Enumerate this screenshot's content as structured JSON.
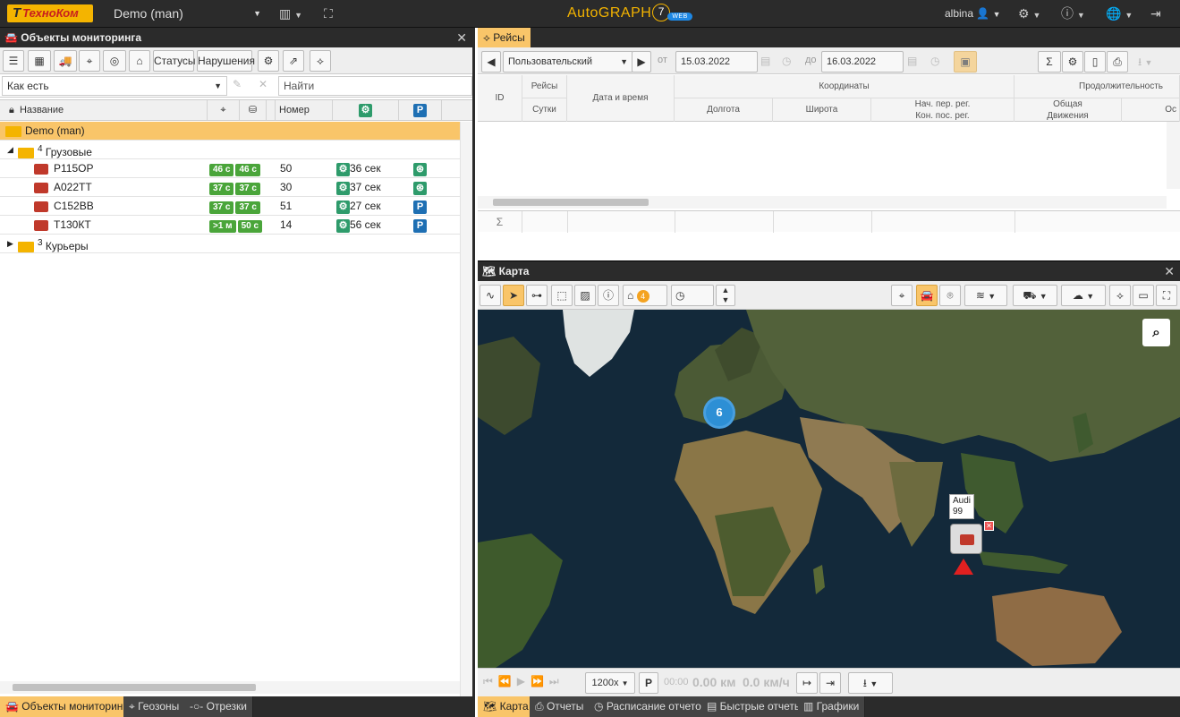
{
  "topbar": {
    "logo_text": "ТехноКом",
    "workspace": "Demo (man)",
    "brand": "AutoGRAPH",
    "brand_version": "7",
    "brand_badge": "WEB",
    "user": "albina",
    "icons": [
      "layout-icon",
      "fullscreen-icon",
      "user-icon",
      "settings-icon",
      "info-icon",
      "globe-icon",
      "logout-icon"
    ]
  },
  "objects_panel": {
    "title": "Объекты мониторинга",
    "toolbar": {
      "statuses": "Статусы",
      "violations": "Нарушения"
    },
    "filter": {
      "value": "Как есть",
      "search_placeholder": "Найти"
    },
    "columns": {
      "name": "Название",
      "number": "Номер"
    },
    "root": "Demo (man)",
    "groups": [
      {
        "count": "4",
        "label": "Грузовые"
      },
      {
        "count": "3",
        "label": "Курьеры"
      }
    ],
    "vehicles": [
      {
        "name": "Р115ОР",
        "b1": "46 с",
        "b2": "46 с",
        "number": "50",
        "status": "36 сек",
        "state": "drive"
      },
      {
        "name": "А022ТТ",
        "b1": "37 с",
        "b2": "37 с",
        "number": "30",
        "status": "37 сек",
        "state": "drive"
      },
      {
        "name": "С152ВВ",
        "b1": "37 с",
        "b2": "37 с",
        "number": "51",
        "status": "27 сек",
        "state": "parking"
      },
      {
        "name": "Т130КТ",
        "b1": ">1 м",
        "b2": "50 с",
        "number": "14",
        "status": "56 сек",
        "state": "parking"
      }
    ],
    "parking_letter": "P",
    "bottom_tabs": [
      "Объекты мониторинга",
      "Геозоны",
      "Отрезки"
    ]
  },
  "trips_panel": {
    "tab": "Рейсы",
    "period_preset": "Пользовательский",
    "from_label": "от",
    "from_value": "15.03.2022 00:00",
    "to_label": "до",
    "to_value": "16.03.2022 00:00",
    "headers": {
      "id": "ID",
      "trips": "Рейсы",
      "days": "Сутки",
      "datetime": "Дата и время",
      "coords": "Координаты",
      "lon": "Долгота",
      "lat": "Широта",
      "reg": "Нач. пер. рег.",
      "reg2": "Кон. пос. рег.",
      "duration": "Продолжительность",
      "total": "Общая",
      "move": "Движения",
      "extra": "Ос"
    },
    "sum_symbol": "Σ"
  },
  "map_panel": {
    "title": "Карта",
    "tag_count": "4",
    "cluster_count": "6",
    "vehicle_label": "Audi",
    "vehicle_number": "99",
    "playback": {
      "speed": "1200x",
      "time": "00:00",
      "distance": "0.00 км",
      "velocity": "0.0 км/ч"
    },
    "bottom_tabs": [
      "Карта",
      "Отчеты",
      "Расписание отчетов",
      "Быстрые отчеты",
      "Графики"
    ]
  }
}
